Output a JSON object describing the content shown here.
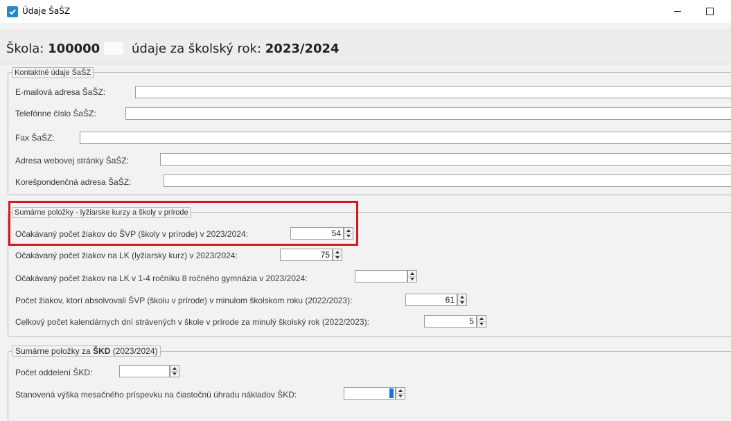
{
  "window": {
    "title": "Údaje ŠaŠZ",
    "minimize_icon": "minimize-icon",
    "maximize_icon": "maximize-icon"
  },
  "header": {
    "school_label": "Škola:",
    "school_code": "100000",
    "year_label": "údaje za školský rok:",
    "year_value": "2023/2024"
  },
  "contacts": {
    "legend": "Kontaktné údaje ŠaŠZ",
    "email_label": "E-mailová adresa ŠaŠZ:",
    "email_value": "",
    "phone_label": "Telefónne číslo ŠaŠZ:",
    "phone_value": "",
    "fax_label": "Fax ŠaŠZ:",
    "fax_value": "",
    "web_label": "Adresa webovej stránky ŠaŠZ:",
    "web_value": "",
    "address_label": "Korešpondenčná adresa ŠaŠZ:",
    "address_value": ""
  },
  "courses": {
    "legend": "Sumárne položky - lyžiarske kurzy a školy v prírode",
    "svp_label": "Očakávaný počet žiakov do ŠVP (školy v prírode) v 2023/2024:",
    "svp_value": "54",
    "lk_label": "Očakávaný počet žiakov na LK (lyžiarsky kurz) v 2023/2024:",
    "lk_value": "75",
    "lk8_label": "Očakávaný počet žiakov na LK v 1-4 ročníku 8 ročného gymnázia v 2023/2024:",
    "lk8_value": "",
    "svp_past_label": "Počet žiakov, ktorí absolvovali ŠVP (školu v prírode) v minulom školskom roku (2022/2023):",
    "svp_past_value": "61",
    "days_label": "Celkový počet kalendárnych dní strávených v škole v prírode za minulý školský rok (2022/2023):",
    "days_value": "5"
  },
  "skd": {
    "legend_prefix": "Sumárne položky za",
    "legend_bold": "ŠKD",
    "legend_suffix": "(2023/2024)",
    "departments_label": "Počet oddelení ŠKD:",
    "departments_value": "",
    "fee_label": "Stanovená výška mesačného príspevku na čiastočnú úhradu nákladov ŠKD:",
    "fee_value": ""
  },
  "accent_colors": {
    "highlight": "#d6171f",
    "caret": "#1e73d8",
    "app_icon": "#1f8ad6"
  }
}
